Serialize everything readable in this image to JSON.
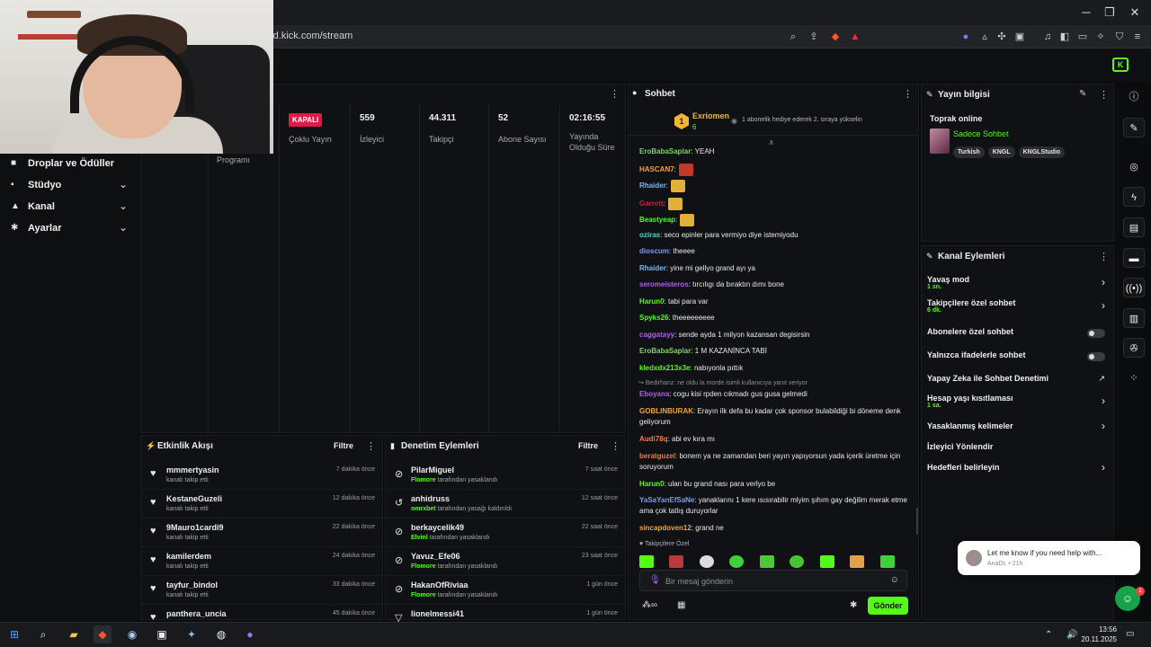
{
  "browser": {
    "url": "rd.kick.com/stream",
    "minimize": "─",
    "restore": "❐",
    "close": "✕"
  },
  "nav": [
    {
      "icon": "gift-icon",
      "label": "Droplar ve Ödüller",
      "chevron": ""
    },
    {
      "icon": "studio-icon",
      "label": "Stüdyo",
      "chevron": "⌄"
    },
    {
      "icon": "channel-icon",
      "label": "Kanal",
      "chevron": "⌄"
    },
    {
      "icon": "gear-icon",
      "label": "Ayarlar",
      "chevron": "⌄"
    }
  ],
  "stats": {
    "program_label": "Programı",
    "status_badge": "KAPALI",
    "status_label": "Çoklu Yayın",
    "viewers_value": "559",
    "viewers_label": "İzleyici",
    "followers_value": "44.311",
    "followers_label": "Takipçi",
    "subs_value": "52",
    "subs_label": "Abone Sayısı",
    "uptime_value": "02:16:55",
    "uptime_label_1": "Yayında",
    "uptime_label_2": "Olduğu Süre"
  },
  "activity": {
    "title": "Etkinlik Akışı",
    "filter": "Filtre",
    "rows": [
      {
        "name": "mmmertyasin",
        "sub": "kanalı takip etti",
        "time": "7 dakika önce"
      },
      {
        "name": "KestaneGuzeli",
        "sub": "kanalı takip etti",
        "time": "12 dakika önce"
      },
      {
        "name": "9Mauro1cardi9",
        "sub": "kanalı takip etti",
        "time": "22 dakika önce"
      },
      {
        "name": "kamilerdem",
        "sub": "kanalı takip etti",
        "time": "24 dakika önce"
      },
      {
        "name": "tayfur_bindol",
        "sub": "kanalı takip etti",
        "time": "33 dakika önce"
      },
      {
        "name": "panthera_uncia",
        "sub": "",
        "time": "45 dakika önce"
      }
    ]
  },
  "moderation": {
    "title": "Denetim Eylemleri",
    "filter": "Filtre",
    "rows": [
      {
        "name": "PilarMiguel",
        "by": "Flomore",
        "sub": " tarafından yasaklandı",
        "time": "7 saat önce"
      },
      {
        "name": "anhidruss",
        "by": "omrxbet",
        "sub": " tarafından yasağı kaldırıldı",
        "time": "12 saat önce"
      },
      {
        "name": "berkaycelik49",
        "by": "Elvinl",
        "sub": " tarafından yasaklandı",
        "time": "22 saat önce"
      },
      {
        "name": "Yavuz_Efe06",
        "by": "Flomore",
        "sub": " tarafından yasaklandı",
        "time": "23 saat önce"
      },
      {
        "name": "HakanOfRiviaa",
        "by": "Flomore",
        "sub": " tarafından yasaklandı",
        "time": "1 gün önce"
      },
      {
        "name": "lionelmessi41",
        "by": "",
        "sub": "",
        "time": "1 gün önce"
      }
    ]
  },
  "chat": {
    "title": "Sohbet",
    "leader_name": "Exriomen",
    "leader_count": "6",
    "leader_rank": "1",
    "leader_note": "1 abonelik hediye ederek 2. sıraya yükselin",
    "messages": [
      {
        "user": "EroBabaSaplar",
        "color": "#7fd36a",
        "text": ": YEAH"
      },
      {
        "user": "HASCAN7",
        "color": "#f2a23c",
        "text": ":"
      },
      {
        "user": "Rhaider",
        "color": "#79b8f2",
        "text": ":"
      },
      {
        "user": "Garrett",
        "color": "#c8203a",
        "text": ":"
      },
      {
        "user": "Beastyeap",
        "color": "#53fc18",
        "text": ":"
      },
      {
        "user": "oziras",
        "color": "#4fd8c3",
        "text": ": seco epinler para vermiyo diye istemiyodu"
      },
      {
        "user": "dioscum",
        "color": "#7b9cf5",
        "text": ": theeee"
      },
      {
        "user": "Rhaider",
        "color": "#79b8f2",
        "text": ": yine mi gellyo grand ayı ya"
      },
      {
        "user": "seromeisteros",
        "color": "#b15ef0",
        "text": ": tırcılıgı da bıraktın dımı bone"
      },
      {
        "user": "Harun0",
        "color": "#53fc18",
        "text": ": tabi para var"
      },
      {
        "user": "Spyks26",
        "color": "#53fc18",
        "text": ": theeeeeeeee"
      },
      {
        "user": "caggatayy",
        "color": "#b15ef0",
        "text": ": sende ayda 1 milyon kazansan degisirsin"
      },
      {
        "user": "EroBabaSaplar",
        "color": "#7fd36a",
        "text": ": 1 M KAZANİNCA TABİ"
      },
      {
        "user": "kledxdx213x3e",
        "color": "#53fc18",
        "text": ": nabıyonla pıttık"
      }
    ],
    "reply_note": "Bedirhanz: ne oldu la morde isimli kullanıcıya yanıt veriyor",
    "messages2": [
      {
        "user": "Eboyana",
        "color": "#b15ef0",
        "text": ": cogu kisi rpden cıkmadı gus gusa gelmedi"
      },
      {
        "user": "GOBLINBURAK",
        "color": "#f2a23c",
        "text": ": Erayın ilk defa bu kadar çok sponsor bulabildiği bi döneme denk geliyorum"
      },
      {
        "user": "Audi78q",
        "color": "#f07a4a",
        "text": ": abi ev kıra mı"
      },
      {
        "user": "beratguzel",
        "color": "#f07a4a",
        "text": ": bonem ya ne zamandan beri yayın yapıyorsun yada içerik üretme için soruyorum"
      },
      {
        "user": "Harun0",
        "color": "#53fc18",
        "text": ": ulan bu grand nası para verlyo be"
      },
      {
        "user": "YaSaYanEfSaNe",
        "color": "#7b9cf5",
        "text": ": yanaklarını 1 kere ısısırabilir mlyim şıhım gay değilim merak etme ama çok tatlış duruyorlar"
      },
      {
        "user": "sincapdoven12",
        "color": "#f2a23c",
        "text": ": grand ne"
      }
    ],
    "followers_only": "Takipçilere Özel",
    "input_placeholder": "Bir mesaj gönderin",
    "send": "Gönder"
  },
  "stream_info": {
    "title": "Yayın bilgisi",
    "stream_title": "Toprak online",
    "category": "Sadece Sohbet",
    "tags": [
      "Turkish",
      "KNGL",
      "KNGLStudio"
    ]
  },
  "channel_actions": {
    "title": "Kanal Eylemleri",
    "items": [
      {
        "label": "Yavaş mod",
        "sub": "1 sn.",
        "control": "chevron"
      },
      {
        "label": "Takipçilere özel sohbet",
        "sub": "6 dk.",
        "control": "chevron"
      },
      {
        "label": "Abonelere özel sohbet",
        "sub": "",
        "control": "toggle"
      },
      {
        "label": "Yalnızca ifadelerle sohbet",
        "sub": "",
        "control": "toggle"
      },
      {
        "label": "Yapay Zeka ile Sohbet Denetimi",
        "sub": "",
        "control": "external"
      },
      {
        "label": "Hesap yaşı kısıtlaması",
        "sub": "1 sa.",
        "control": "chevron"
      },
      {
        "label": "Yasaklanmış kelimeler",
        "sub": "",
        "control": "chevron"
      },
      {
        "label": "İzleyici Yönlendir",
        "sub": "",
        "control": "none"
      },
      {
        "label": "Hedefleri belirleyin",
        "sub": "",
        "control": "chevron"
      }
    ]
  },
  "popup": {
    "message": "Let me know if you need help with...",
    "meta": "AnaDr. • 21h",
    "badge": "1"
  },
  "taskbar": {
    "time": "13:56",
    "date": "20.11.2025"
  },
  "colors": {
    "accent": "#53fc18",
    "danger": "#e0194b"
  }
}
